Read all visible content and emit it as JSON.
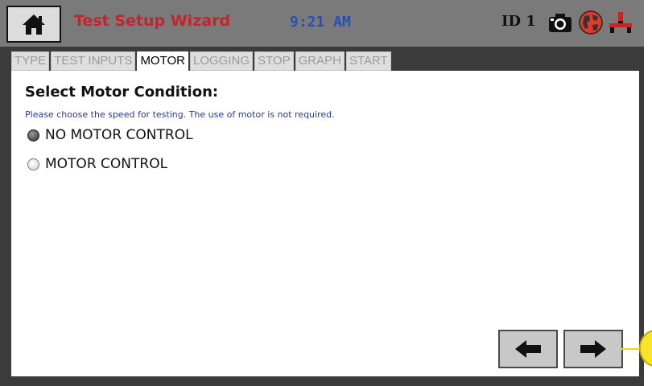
{
  "header": {
    "title": "Test Setup Wizard",
    "time": "9:21 AM",
    "station_id": "ID 1",
    "title_color": "#c8232c",
    "time_color": "#2850b4",
    "icons": [
      "home-icon",
      "camera-icon",
      "globe-icon",
      "network-icon"
    ]
  },
  "tabs": [
    {
      "label": "TYPE",
      "active": false
    },
    {
      "label": "TEST INPUTS",
      "active": false
    },
    {
      "label": "MOTOR",
      "active": true
    },
    {
      "label": "LOGGING",
      "active": false
    },
    {
      "label": "STOP",
      "active": false
    },
    {
      "label": "GRAPH",
      "active": false
    },
    {
      "label": "START",
      "active": false
    }
  ],
  "panel": {
    "heading": "Select Motor Condition:",
    "instruction": "Please choose the speed for testing.  The use of motor is not required.",
    "options": [
      {
        "label": "NO MOTOR CONTROL",
        "selected": true
      },
      {
        "label": "MOTOR CONTROL",
        "selected": false
      }
    ]
  },
  "nav": {
    "back_icon": "arrow-left-icon",
    "next_icon": "arrow-right-icon"
  }
}
